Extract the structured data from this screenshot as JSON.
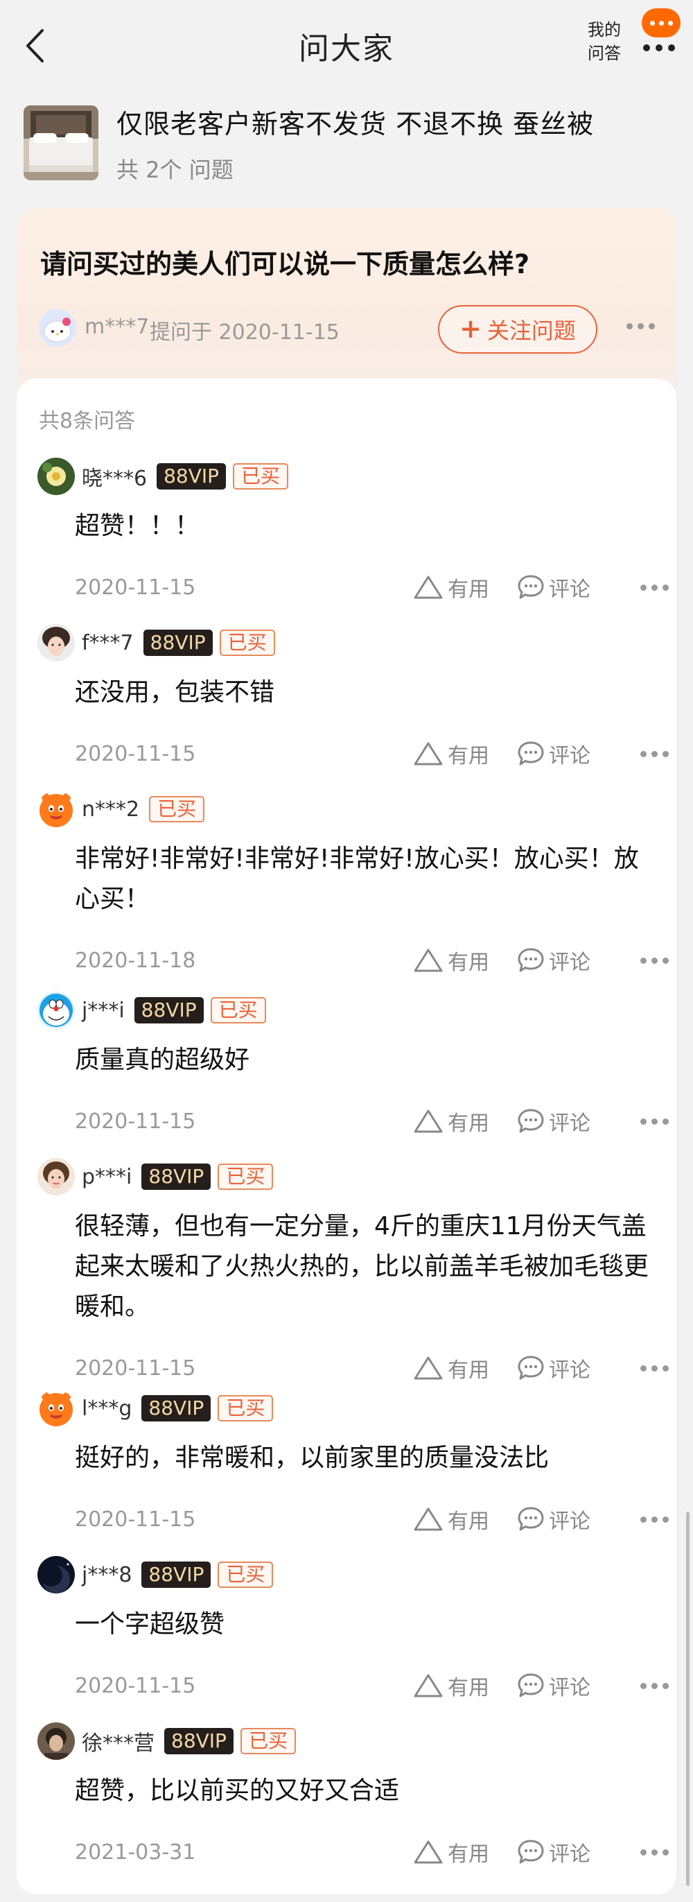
{
  "header": {
    "title": "问大家",
    "my_qa_label": "我的问答"
  },
  "product": {
    "title": "仅限老客户新客不发货 不退不换 蚕丝被",
    "question_count": "共 2个 问题"
  },
  "question": {
    "text": "请问买过的美人们可以说一下质量怎么样?",
    "asker": "m***7",
    "asked_at": "提问于 2020-11-15",
    "follow_label": "关注问题"
  },
  "answers_summary": "共8条问答",
  "labels": {
    "vip": "88VIP",
    "bought": "已买",
    "useful": "有用",
    "comment": "评论"
  },
  "answers": [
    {
      "user": "晓***6",
      "vip": true,
      "bought": true,
      "text": "超赞！！！",
      "date": "2020-11-15",
      "avatar": "flower"
    },
    {
      "user": "f***7",
      "vip": true,
      "bought": true,
      "text": "还没用，包装不错",
      "date": "2020-11-15",
      "avatar": "girl"
    },
    {
      "user": "n***2",
      "vip": false,
      "bought": true,
      "text": "非常好!非常好!非常好!非常好!放心买！放心买！放心买！",
      "date": "2020-11-18",
      "avatar": "taobao"
    },
    {
      "user": "j***i",
      "vip": true,
      "bought": true,
      "text": "质量真的超级好",
      "date": "2020-11-15",
      "avatar": "doraemon"
    },
    {
      "user": "p***i",
      "vip": true,
      "bought": true,
      "text": "很轻薄，但也有一定分量，4斤的重庆11月份天气盖起来太暖和了火热火热的，比以前盖羊毛被加毛毯更暖和。",
      "date": "2020-11-15",
      "avatar": "woman"
    },
    {
      "user": "l***g",
      "vip": true,
      "bought": true,
      "text": "挺好的，非常暖和，以前家里的质量没法比",
      "date": "2020-11-15",
      "avatar": "taobao"
    },
    {
      "user": "j***8",
      "vip": true,
      "bought": true,
      "text": "一个字超级赞",
      "date": "2020-11-15",
      "avatar": "moon"
    },
    {
      "user": "徐***营",
      "vip": true,
      "bought": true,
      "text": "超赞，比以前买的又好又合适",
      "date": "2021-03-31",
      "avatar": "portrait"
    }
  ],
  "colors": {
    "accent": "#e8623a",
    "brand_orange": "#ff6a00",
    "vip_bg": "#241f1c",
    "vip_text": "#f5d9a7"
  }
}
